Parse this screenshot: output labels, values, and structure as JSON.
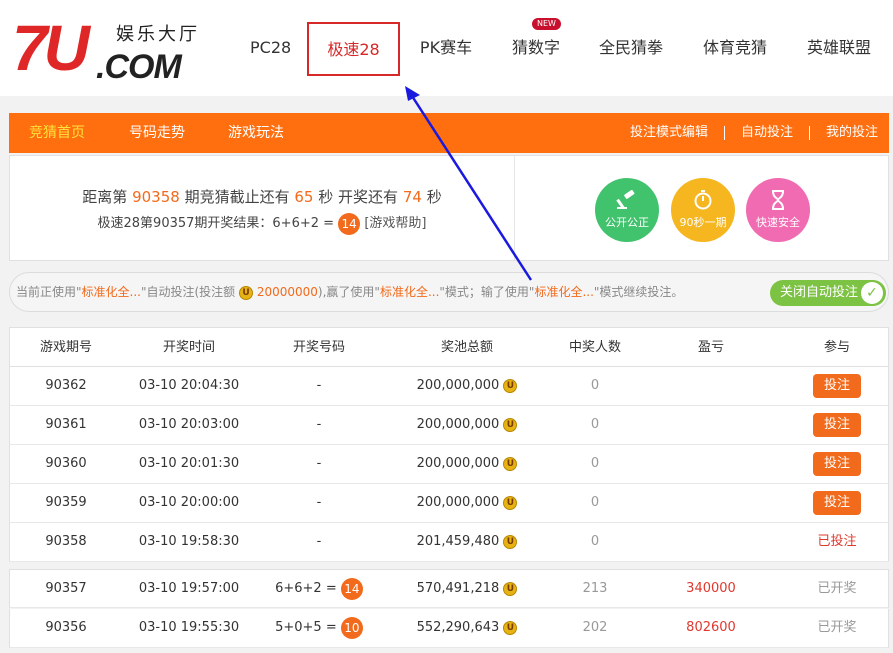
{
  "header": {
    "logo_main": "7U",
    "logo_com": ".COM",
    "logo_sub": "娱乐大厅",
    "nav": [
      {
        "label": "PC28",
        "active": false
      },
      {
        "label": "极速28",
        "active": true
      },
      {
        "label": "PK赛车",
        "active": false
      },
      {
        "label": "猜数字",
        "active": false,
        "badge": "NEW"
      },
      {
        "label": "全民猜拳",
        "active": false
      },
      {
        "label": "体育竞猜",
        "active": false
      },
      {
        "label": "英雄联盟",
        "active": false
      }
    ]
  },
  "subnav": {
    "left": [
      "竞猜首页",
      "号码走势",
      "游戏玩法"
    ],
    "right": [
      "投注模式编辑",
      "自动投注",
      "我的投注"
    ]
  },
  "info": {
    "line1_pre": "距离第",
    "period": "90358",
    "line1_mid": "期竞猜截止还有",
    "seconds_close": "65",
    "line1_mid2": "秒 开奖还有",
    "seconds_draw": "74",
    "line1_post": "秒",
    "line2_pre": "极速28第90357期开奖结果：6+6+2 =",
    "result": "14",
    "help": "[游戏帮助]",
    "features": [
      {
        "label": "公开公正",
        "icon": "gavel-icon",
        "color": "#41c26d"
      },
      {
        "label": "90秒一期",
        "icon": "stopwatch-icon",
        "color": "#f5b61f"
      },
      {
        "label": "快速安全",
        "icon": "hourglass-icon",
        "color": "#f06bb1"
      }
    ]
  },
  "status": {
    "t1": "当前正使用\"",
    "mode1": "标准化全...",
    "t2": "\"自动投注(投注额",
    "amount": "20000000",
    "t3": "),赢了使用\"",
    "mode2": "标准化全...",
    "t4": "\"模式；输了使用\"",
    "mode3": "标准化全...",
    "t5": "\"模式继续投注。",
    "toggle_label": "关闭自动投注"
  },
  "table": {
    "headers": [
      "游戏期号",
      "开奖时间",
      "开奖号码",
      "奖池总额",
      "中奖人数",
      "盈亏",
      "参与"
    ],
    "rows": [
      {
        "period": "90362",
        "time": "03-10 20:04:30",
        "numbers": "-",
        "result": "",
        "pool": "200,000,000",
        "winners": "0",
        "profit": "",
        "action": "投注",
        "status": "bet"
      },
      {
        "period": "90361",
        "time": "03-10 20:03:00",
        "numbers": "-",
        "result": "",
        "pool": "200,000,000",
        "winners": "0",
        "profit": "",
        "action": "投注",
        "status": "bet"
      },
      {
        "period": "90360",
        "time": "03-10 20:01:30",
        "numbers": "-",
        "result": "",
        "pool": "200,000,000",
        "winners": "0",
        "profit": "",
        "action": "投注",
        "status": "bet"
      },
      {
        "period": "90359",
        "time": "03-10 20:00:00",
        "numbers": "-",
        "result": "",
        "pool": "200,000,000",
        "winners": "0",
        "profit": "",
        "action": "投注",
        "status": "bet"
      },
      {
        "period": "90358",
        "time": "03-10 19:58:30",
        "numbers": "-",
        "result": "",
        "pool": "201,459,480",
        "winners": "0",
        "profit": "",
        "action": "已投注",
        "status": "done"
      },
      {
        "period": "90357",
        "time": "03-10 19:57:00",
        "numbers": "6+6+2 =",
        "result": "14",
        "pool": "570,491,218",
        "winners": "213",
        "profit": "340000",
        "action": "已开奖",
        "status": "drawn"
      },
      {
        "period": "90356",
        "time": "03-10 19:55:30",
        "numbers": "5+0+5 =",
        "result": "10",
        "pool": "552,290,643",
        "winners": "202",
        "profit": "802600",
        "action": "已开奖",
        "status": "drawn"
      }
    ]
  },
  "coin_glyph": "U",
  "colors": {
    "orange": "#ff6f0f",
    "accent": "#f26a1b",
    "red": "#d62828",
    "green": "#7cc243",
    "arrow": "#1a1adf"
  }
}
